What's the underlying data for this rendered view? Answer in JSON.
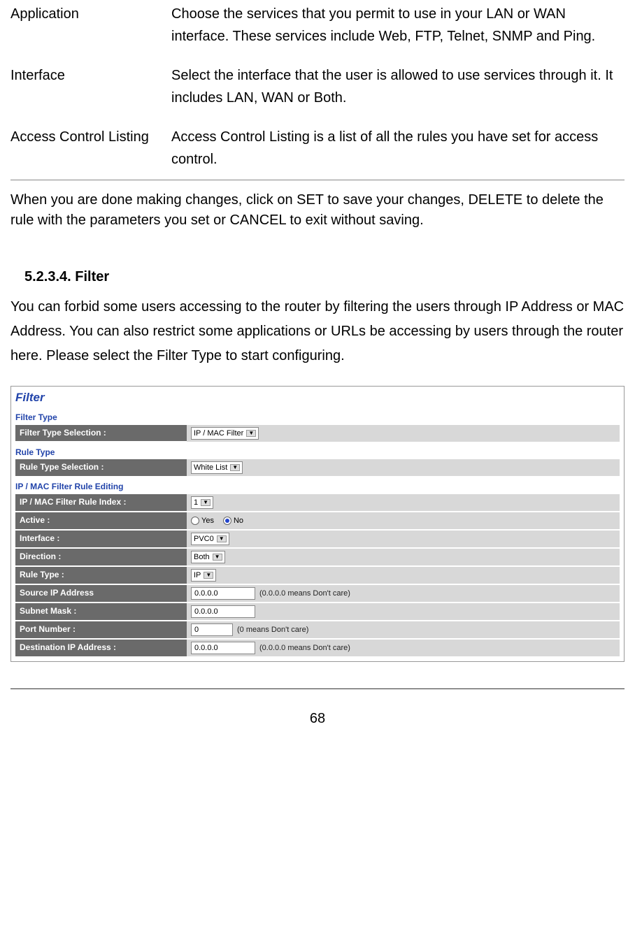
{
  "definitions": [
    {
      "term": "Application",
      "desc": "Choose the services that you permit to use in your LAN or WAN interface. These services include Web, FTP, Telnet, SNMP and Ping."
    },
    {
      "term": "Interface",
      "desc": "Select the interface that the user is allowed to use services through it. It includes LAN, WAN or Both."
    },
    {
      "term": "Access Control Listing",
      "desc": "Access Control Listing is a list of all the rules you have set for access control."
    }
  ],
  "paragraph1": "When you are done making changes, click on SET to save your changes, DELETE to delete the rule with the parameters you set or CANCEL to exit without saving.",
  "section": {
    "number": "5.2.3.4. Filter",
    "body": "You can forbid some users accessing to the router by filtering the users through IP Address or MAC Address. You can also restrict some applications or URLs be accessing by users through the router here. Please select the Filter Type to start configuring."
  },
  "panel": {
    "title": "Filter",
    "filterType": {
      "heading": "Filter Type",
      "label": "Filter Type Selection :",
      "value": "IP / MAC Filter"
    },
    "ruleType": {
      "heading": "Rule Type",
      "label": "Rule Type Selection :",
      "value": "White List"
    },
    "editing": {
      "heading": "IP / MAC Filter Rule Editing",
      "ruleIndex": {
        "label": "IP / MAC Filter Rule Index :",
        "value": "1"
      },
      "active": {
        "label": "Active :",
        "yes": "Yes",
        "no": "No"
      },
      "interface": {
        "label": "Interface :",
        "value": "PVC0"
      },
      "direction": {
        "label": "Direction :",
        "value": "Both"
      },
      "ruleTypeRow": {
        "label": "Rule Type :",
        "value": "IP"
      },
      "sourceIp": {
        "label": "Source IP Address",
        "value": "0.0.0.0",
        "hint": "(0.0.0.0 means Don't care)"
      },
      "subnet": {
        "label": "Subnet Mask :",
        "value": "0.0.0.0"
      },
      "port": {
        "label": "Port Number :",
        "value": "0",
        "hint": "(0 means Don't care)"
      },
      "destIp": {
        "label": "Destination IP Address :",
        "value": "0.0.0.0",
        "hint": "(0.0.0.0 means Don't care)"
      }
    }
  },
  "pageNumber": "68"
}
